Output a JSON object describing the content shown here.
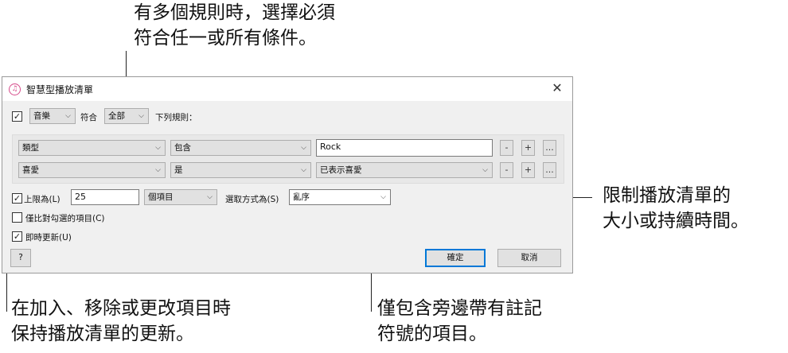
{
  "callouts": {
    "top": "有多個規則時，選擇必須\n符合任一或所有條件。",
    "right": "限制播放清單的\n大小或持續時間。",
    "bottom_left": "在加入、移除或更改項目時\n保持播放清單的更新。",
    "bottom_right": "僅包含旁邊帶有註記\n符號的項目。"
  },
  "dialog": {
    "title": "智慧型播放清單",
    "close_glyph": "✕",
    "match": {
      "checked": true,
      "media_type": "音樂",
      "conform_label": "符合",
      "quantifier": "全部",
      "rules_label": "下列規則："
    },
    "rules": [
      {
        "field": "類型",
        "operator": "包含",
        "value": "Rock",
        "value_is_dropdown": false
      },
      {
        "field": "喜愛",
        "operator": "是",
        "value": "已表示喜愛",
        "value_is_dropdown": true
      }
    ],
    "rule_buttons": {
      "remove": "-",
      "add": "+",
      "more": "..."
    },
    "limit": {
      "checked": true,
      "label": "上限為(L)",
      "value": "25",
      "unit": "個項目",
      "select_by_label": "選取方式為(S)",
      "select_by": "亂序"
    },
    "checked_only": {
      "checked": false,
      "label": "僅比對勾選的項目(C)"
    },
    "live_update": {
      "checked": true,
      "label": "即時更新(U)"
    },
    "help_label": "?",
    "ok_label": "確定",
    "cancel_label": "取消"
  }
}
